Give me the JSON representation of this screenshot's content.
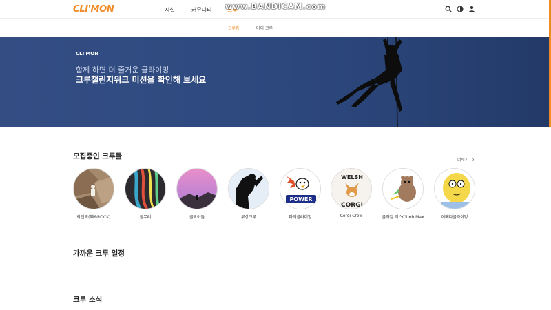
{
  "watermark": "www.BANDICAM.com",
  "brand": {
    "logo": "CLI'MON",
    "color": "#f08a24"
  },
  "nav": {
    "items": [
      {
        "label": "시설"
      },
      {
        "label": "커뮤니티"
      },
      {
        "label": "크루"
      }
    ],
    "active_index": 2,
    "icons": [
      "search-icon",
      "theme-toggle-icon",
      "user-icon"
    ]
  },
  "subnav": {
    "items": [
      {
        "label": "크루홈"
      },
      {
        "label": "마이 크루"
      }
    ],
    "active_index": 0
  },
  "hero": {
    "brand": "CLI'MON",
    "line1": "함께 하면 더 즐거운 클라이밍",
    "line2": "크루챌린지위크 미션을 확인해 보세요"
  },
  "recruiting": {
    "title": "모집중인 크루들",
    "more": "더보기",
    "crews": [
      {
        "name": "락앤락(樂&ROCK)"
      },
      {
        "name": "돌무리"
      },
      {
        "name": "클락이들"
      },
      {
        "name": "루상크루"
      },
      {
        "name": "파워클라이밍"
      },
      {
        "name": "Corgi Crew"
      },
      {
        "name": "클라임 맥스Climb Max"
      },
      {
        "name": "어메다클라이밍"
      }
    ]
  },
  "schedule": {
    "title": "가까운 크루 일정"
  },
  "news": {
    "title": "크루 소식"
  }
}
